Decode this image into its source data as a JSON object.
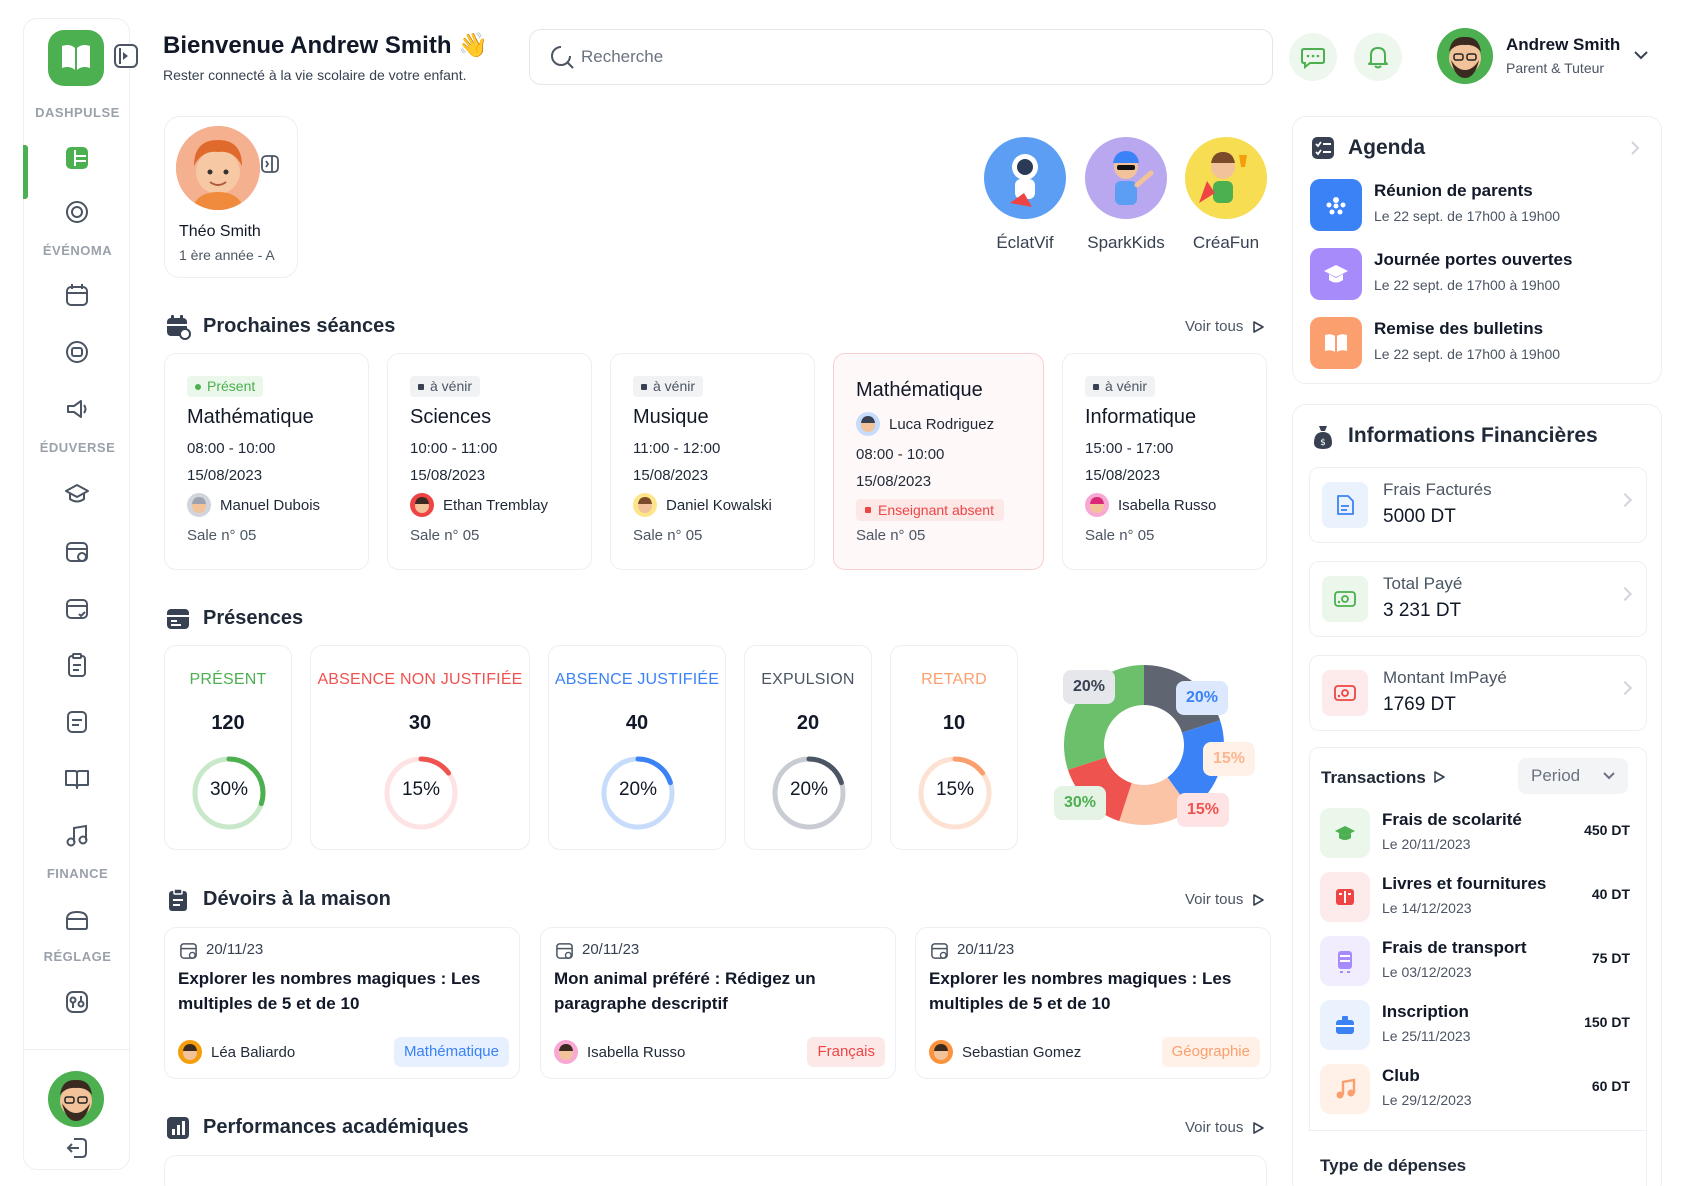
{
  "sidebar": {
    "sections": [
      "DASHPULSE",
      "ÉVÉNOMA",
      "ÉDUVERSE",
      "FINANCE",
      "RÉGLAGE"
    ]
  },
  "header": {
    "welcome": "Bienvenue Andrew Smith 👋",
    "subtitle": "Rester connecté à la vie scolaire de votre enfant.",
    "search_placeholder": "Recherche",
    "user_name": "Andrew Smith",
    "user_role": "Parent & Tuteur"
  },
  "child": {
    "name": "Théo Smith",
    "grade": "1 ère année - A"
  },
  "clubs": [
    {
      "name": "ÉclatVif",
      "color": "#5b9ef3"
    },
    {
      "name": "SparkKids",
      "color": "#b9a7f0"
    },
    {
      "name": "CréaFun",
      "color": "#f7dd52"
    }
  ],
  "seances": {
    "title": "Prochaines séances",
    "voir": "Voir tous",
    "items": [
      {
        "badge": "Présent",
        "subject": "Mathématique",
        "time": "08:00 - 10:00",
        "date": "15/08/2023",
        "teacher": "Manuel Dubois",
        "room": "Sale n° 05"
      },
      {
        "badge": "à vénir",
        "subject": "Sciences",
        "time": "10:00 - 11:00",
        "date": "15/08/2023",
        "teacher": "Ethan Tremblay",
        "room": "Sale n° 05"
      },
      {
        "badge": "à vénir",
        "subject": "Musique",
        "time": "11:00 - 12:00",
        "date": "15/08/2023",
        "teacher": "Daniel Kowalski",
        "room": "Sale n° 05"
      },
      {
        "subject": "Mathématique",
        "teacher": "Luca Rodriguez",
        "time": "08:00 - 10:00",
        "date": "15/08/2023",
        "absent": "Enseignant absent",
        "room": "Sale n° 05"
      },
      {
        "badge": "à vénir",
        "subject": "Informatique",
        "time": "15:00 - 17:00",
        "date": "15/08/2023",
        "teacher": "Isabella Russo",
        "room": "Sale n° 05"
      }
    ]
  },
  "presences": {
    "title": "Présences",
    "items": [
      {
        "label": "PRÉSENT",
        "count": "120",
        "pct": "30%",
        "value": 30,
        "color": "#4caf50",
        "light": "#c9e8c9"
      },
      {
        "label": "ABSENCE NON JUSTIFIÉE",
        "count": "30",
        "pct": "15%",
        "value": 15,
        "color": "#ef5350",
        "light": "#fde3e3"
      },
      {
        "label": "ABSENCE JUSTIFIÉE",
        "count": "40",
        "pct": "20%",
        "value": 20,
        "color": "#3b82f6",
        "light": "#c7dcfb"
      },
      {
        "label": "EXPULSION",
        "count": "20",
        "pct": "20%",
        "value": 20,
        "color": "#4b5563",
        "light": "#c9cdd3"
      },
      {
        "label": "RETARD",
        "count": "10",
        "pct": "15%",
        "value": 15,
        "color": "#fb9f6e",
        "light": "#fde2d3"
      }
    ],
    "pie_labels": [
      "20%",
      "20%",
      "15%",
      "15%",
      "30%"
    ]
  },
  "devoirs": {
    "title": "Dévoirs à la maison",
    "voir": "Voir tous",
    "items": [
      {
        "date": "20/11/23",
        "title": "Explorer les nombres magiques : Les multiples de 5 et de 10",
        "teacher": "Léa Baliardo",
        "tag": "Mathématique",
        "tag_color": "#3b82f6",
        "tag_bg": "#e6f0fe"
      },
      {
        "date": "20/11/23",
        "title": "Mon animal préféré : Rédigez un paragraphe descriptif",
        "teacher": "Isabella Russo",
        "tag": "Français",
        "tag_color": "#ef4444",
        "tag_bg": "#fde8e8"
      },
      {
        "date": "20/11/23",
        "title": "Explorer les nombres magiques : Les multiples de 5 et de 10",
        "teacher": "Sebastian Gomez",
        "tag": "Géographie",
        "tag_color": "#fb9f6e",
        "tag_bg": "#fff1e8"
      }
    ]
  },
  "performances": {
    "title": "Performances académiques",
    "voir": "Voir tous"
  },
  "agenda": {
    "title": "Agenda",
    "items": [
      {
        "title": "Réunion de parents",
        "sub": "Le 22 sept. de 17h00 à 19h00",
        "color": "#3b82f6"
      },
      {
        "title": "Journée portes ouvertes",
        "sub": "Le 22 sept. de 17h00 à 19h00",
        "color": "#a78bfa"
      },
      {
        "title": "Remise des bulletins",
        "sub": "Le 22 sept. de 17h00 à 19h00",
        "color": "#fb9f6e"
      }
    ]
  },
  "finances": {
    "title": "Informations Financières",
    "items": [
      {
        "label": "Frais Facturés",
        "value": "5000 DT",
        "color": "#3b82f6",
        "bg": "#eaf2fe"
      },
      {
        "label": "Total Payé",
        "value": "3 231 DT",
        "color": "#4caf50",
        "bg": "#eaf7ea"
      },
      {
        "label": "Montant ImPayé",
        "value": "1769 DT",
        "color": "#ef4444",
        "bg": "#fdeaea"
      }
    ]
  },
  "transactions": {
    "title": "Transactions",
    "period": "Period",
    "items": [
      {
        "title": "Frais de scolarité",
        "date": "Le 20/11/2023",
        "amount": "450 DT",
        "color": "#4caf50",
        "bg": "#eaf7ea"
      },
      {
        "title": "Livres et fournitures",
        "date": "Le 14/12/2023",
        "amount": "40 DT",
        "color": "#ef4444",
        "bg": "#fdeaea"
      },
      {
        "title": "Frais de transport",
        "date": "Le 03/12/2023",
        "amount": "75 DT",
        "color": "#a78bfa",
        "bg": "#f1ecfe"
      },
      {
        "title": "Inscription",
        "date": "Le 25/11/2023",
        "amount": "150 DT",
        "color": "#3b82f6",
        "bg": "#eaf2fe"
      },
      {
        "title": "Club",
        "date": "Le 29/12/2023",
        "amount": "60 DT",
        "color": "#fb9f6e",
        "bg": "#fff1e8"
      }
    ],
    "footer": "Type de dépenses"
  }
}
